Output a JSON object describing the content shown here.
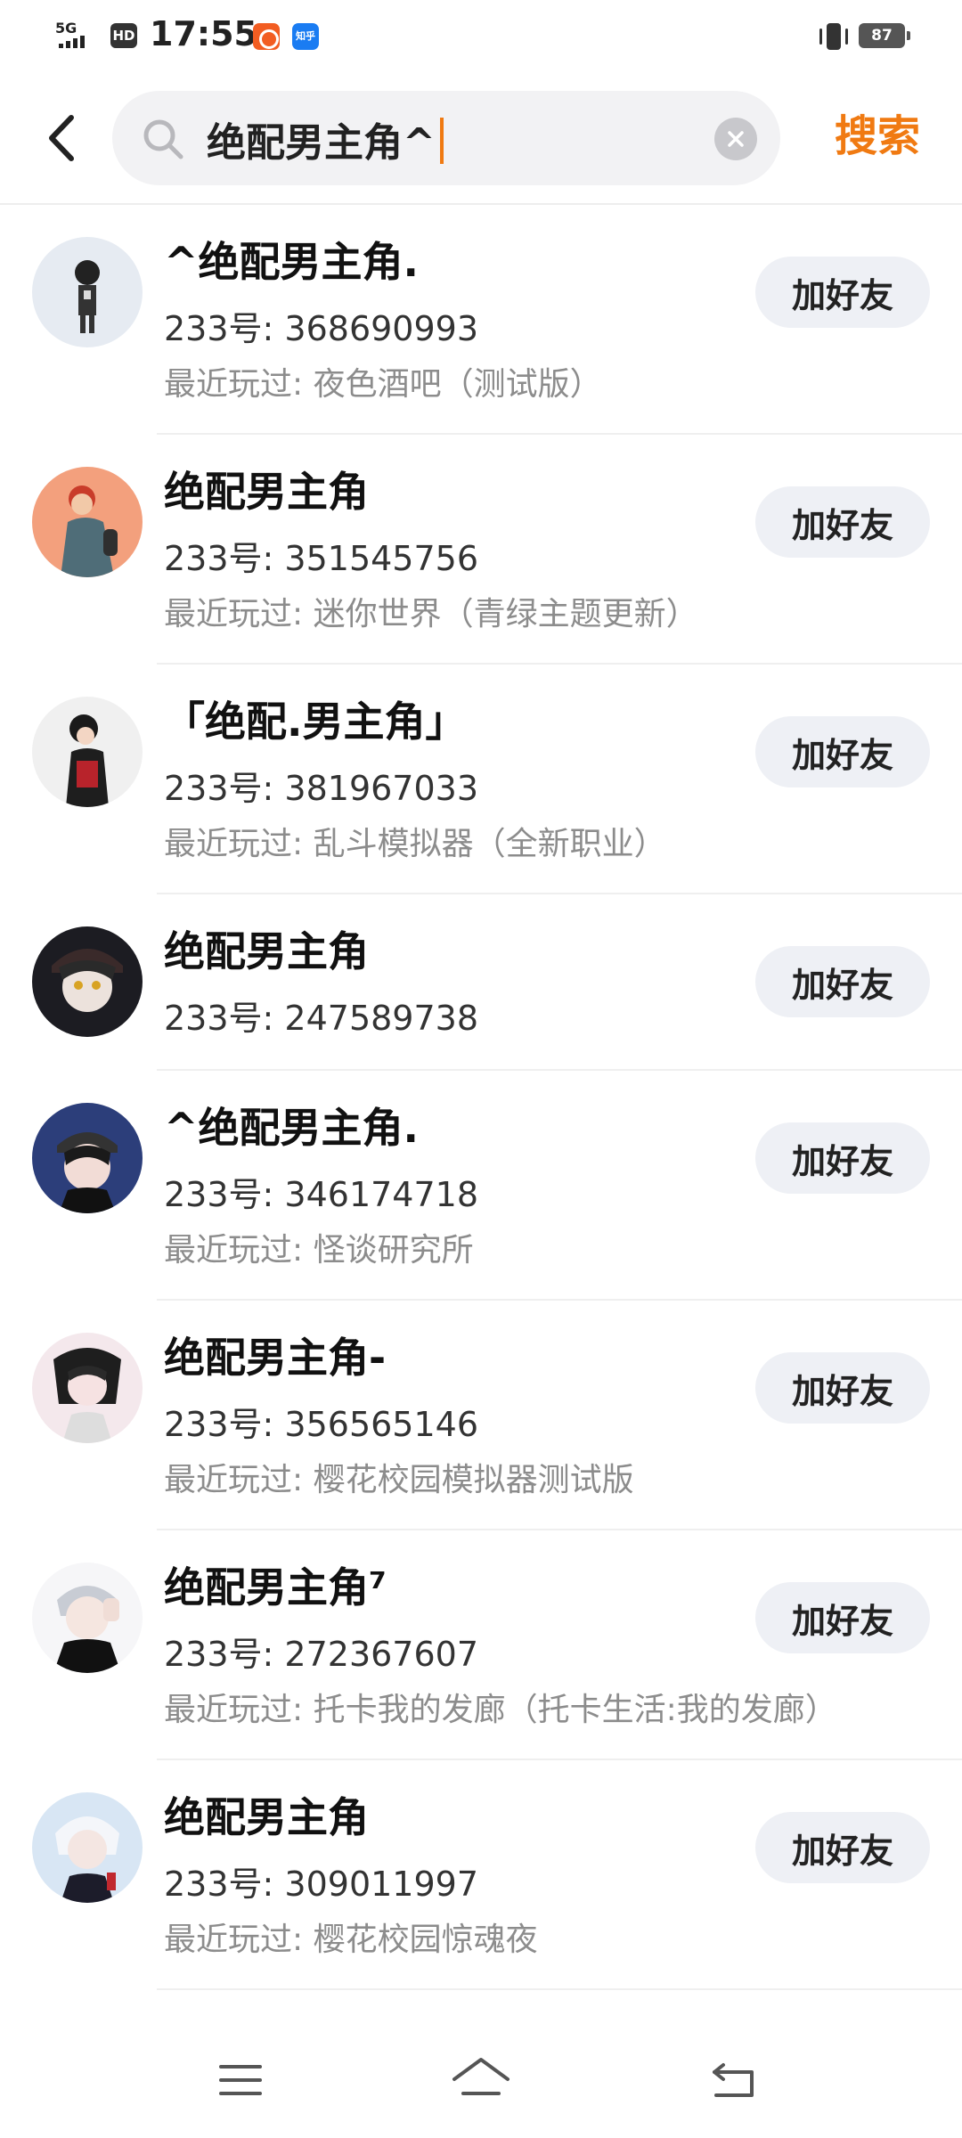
{
  "status_bar": {
    "network": "5G",
    "hd": "HD",
    "time": "17:55",
    "app2_label": "知乎",
    "battery": "87"
  },
  "search": {
    "query": "绝配男主角^",
    "submit_label": "搜索",
    "accent_color": "#f07a12"
  },
  "results": [
    {
      "name": "^绝配男主角.",
      "uid": "233号: 368690993",
      "recent": "最近玩过: 夜色酒吧（测试版）",
      "button": "加好友"
    },
    {
      "name": "绝配男主角",
      "uid": "233号: 351545756",
      "recent": "最近玩过: 迷你世界（青绿主题更新）",
      "button": "加好友"
    },
    {
      "name": "「绝配.男主角」",
      "uid": "233号: 381967033",
      "recent": "最近玩过: 乱斗模拟器（全新职业）",
      "button": "加好友"
    },
    {
      "name": "绝配男主角",
      "uid": "233号: 247589738",
      "recent": "",
      "button": "加好友"
    },
    {
      "name": "^绝配男主角.",
      "uid": "233号: 346174718",
      "recent": "最近玩过: 怪谈研究所",
      "button": "加好友"
    },
    {
      "name": "绝配男主角-",
      "uid": "233号: 356565146",
      "recent": "最近玩过: 樱花校园模拟器测试版",
      "button": "加好友"
    },
    {
      "name": "绝配男主角⁷",
      "uid": "233号: 272367607",
      "recent": "最近玩过: 托卡我的发廊（托卡生活:我的发廊）",
      "button": "加好友"
    },
    {
      "name": "绝配男主角",
      "uid": "233号: 309011997",
      "recent": "最近玩过: 樱花校园惊魂夜",
      "button": "加好友"
    }
  ],
  "icons": {
    "back": "back-arrow-icon",
    "search": "search-icon",
    "clear": "clear-icon",
    "nav_menu": "menu-icon",
    "nav_home": "home-icon",
    "nav_back": "back-icon"
  }
}
